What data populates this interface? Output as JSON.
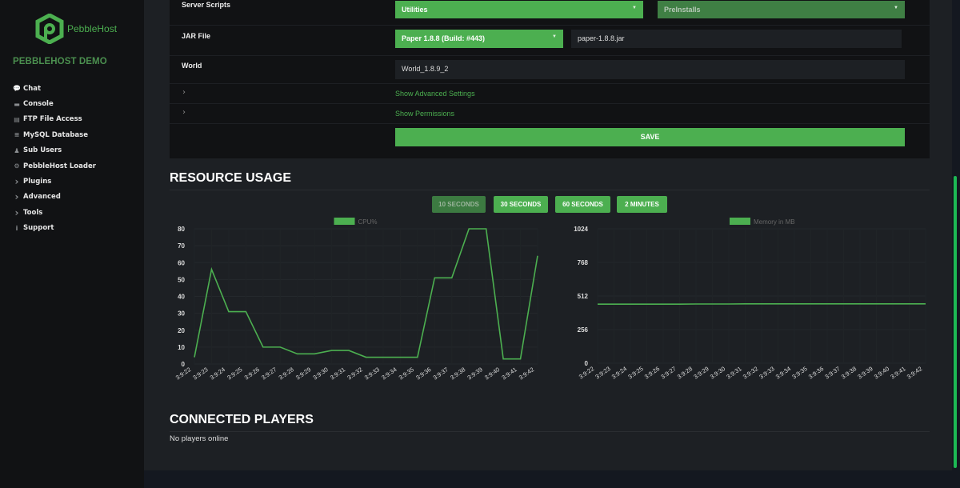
{
  "brand": {
    "name": "PebbleHost",
    "color": "#4caf50"
  },
  "server": {
    "name": "PEBBLEHOST DEMO"
  },
  "sidebar": {
    "items": [
      {
        "label": "Chat",
        "icon": "chat-icon",
        "glyph": "💬"
      },
      {
        "label": "Console",
        "icon": "console-icon",
        "glyph": "▬"
      },
      {
        "label": "FTP File Access",
        "icon": "file-icon",
        "glyph": "▤"
      },
      {
        "label": "MySQL Database",
        "icon": "database-icon",
        "glyph": "≡"
      },
      {
        "label": "Sub Users",
        "icon": "user-icon",
        "glyph": "♟"
      },
      {
        "label": "PebbleHost Loader",
        "icon": "gear-icon",
        "glyph": "⚙"
      },
      {
        "label": "Plugins",
        "icon": "chevron-right-icon",
        "glyph": "›"
      },
      {
        "label": "Advanced",
        "icon": "chevron-right-icon",
        "glyph": "›"
      },
      {
        "label": "Tools",
        "icon": "chevron-right-icon",
        "glyph": "›"
      },
      {
        "label": "Support",
        "icon": "info-icon",
        "glyph": "i"
      }
    ]
  },
  "settings": {
    "server_scripts": {
      "label": "Server Scripts",
      "select1": "Utilities",
      "select2": "PreInstalls"
    },
    "jar_file": {
      "label": "JAR File",
      "select": "Paper 1.8.8 (Build: #443)",
      "value": "paper-1.8.8.jar"
    },
    "world": {
      "label": "World",
      "value": "World_1.8.9_2"
    },
    "advanced_link": "Show Advanced Settings",
    "permissions_link": "Show Permissions",
    "save_label": "SAVE"
  },
  "resource_usage": {
    "title": "RESOURCE USAGE",
    "ranges": [
      "10 SECONDS",
      "30 SECONDS",
      "60 SECONDS",
      "2 MINUTES"
    ],
    "active_range": "10 SECONDS"
  },
  "chart_data": [
    {
      "type": "line",
      "title": "",
      "legend": "CPU%",
      "legend_position": "top-center",
      "x": [
        "3:9:22",
        "3:9:23",
        "3:9:24",
        "3:9:25",
        "3:9:26",
        "3:9:27",
        "3:9:28",
        "3:9:29",
        "3:9:30",
        "3:9:31",
        "3:9:32",
        "3:9:33",
        "3:9:34",
        "3:9:35",
        "3:9:36",
        "3:9:37",
        "3:9:38",
        "3:9:39",
        "3:9:40",
        "3:9:41",
        "3:9:42"
      ],
      "values": [
        4,
        56,
        31,
        31,
        10,
        10,
        6,
        6,
        8,
        8,
        4,
        4,
        4,
        4,
        51,
        51,
        80,
        80,
        3,
        3,
        64
      ],
      "yticks": [
        0,
        10,
        20,
        30,
        40,
        50,
        60,
        70,
        80
      ],
      "ylim": [
        0,
        80
      ],
      "color": "#4caf50",
      "grid": true
    },
    {
      "type": "line",
      "title": "",
      "legend": "Memory in MB",
      "legend_position": "top-center",
      "x": [
        "3:9:22",
        "3:9:23",
        "3:9:24",
        "3:9:25",
        "3:9:26",
        "3:9:27",
        "3:9:28",
        "3:9:29",
        "3:9:30",
        "3:9:31",
        "3:9:32",
        "3:9:33",
        "3:9:34",
        "3:9:35",
        "3:9:36",
        "3:9:37",
        "3:9:38",
        "3:9:39",
        "3:9:40",
        "3:9:41",
        "3:9:42"
      ],
      "values": [
        450,
        450,
        450,
        450,
        450,
        450,
        451,
        451,
        451,
        452,
        452,
        452,
        452,
        452,
        452,
        452,
        452,
        452,
        452,
        452,
        452
      ],
      "yticks": [
        0,
        256,
        512,
        768,
        1024
      ],
      "ylim": [
        0,
        1024
      ],
      "color": "#4caf50",
      "grid": true
    }
  ],
  "players": {
    "title": "CONNECTED PLAYERS",
    "empty_text": "No players online"
  }
}
